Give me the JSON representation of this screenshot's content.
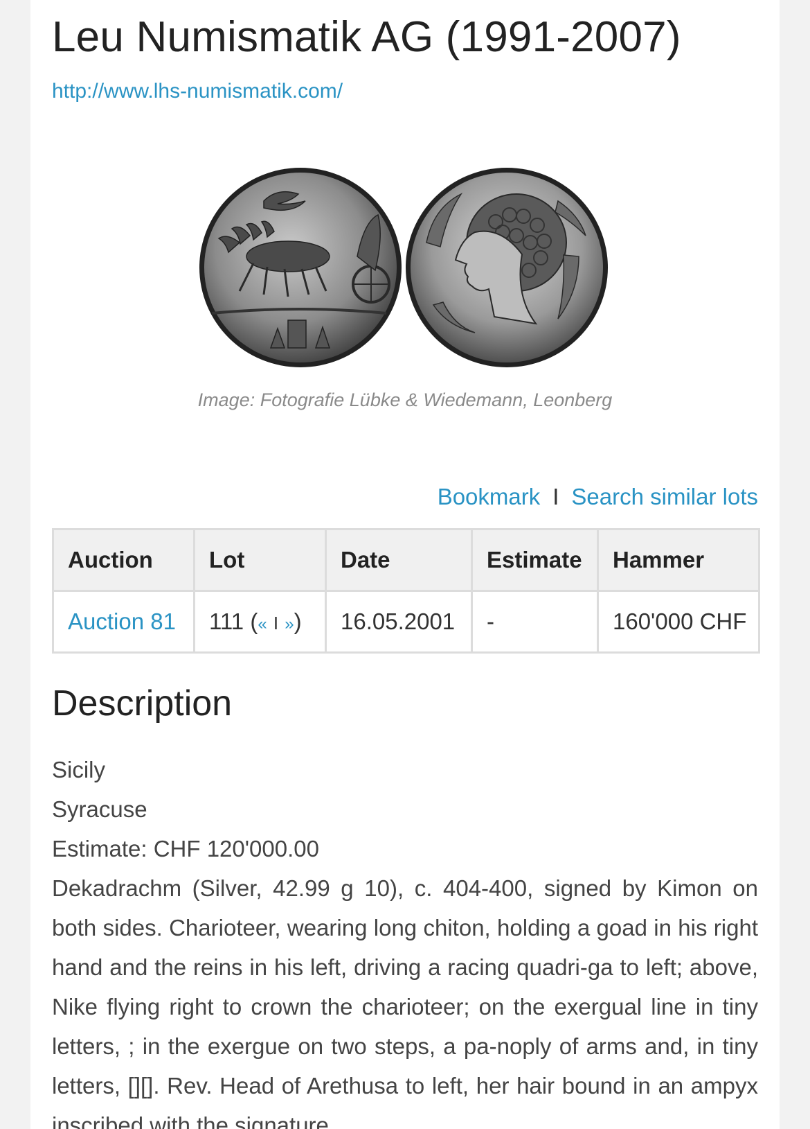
{
  "header": {
    "title": "Leu Numismatik AG (1991-2007)",
    "link": "http://www.lhs-numismatik.com/"
  },
  "image": {
    "caption": "Image: Fotografie Lübke & Wiedemann, Leonberg"
  },
  "actions": {
    "bookmark": "Bookmark",
    "separator": "I",
    "search_similar": "Search similar lots"
  },
  "table": {
    "headers": [
      "Auction",
      "Lot",
      "Date",
      "Estimate",
      "Hammer"
    ],
    "row": {
      "auction": "Auction 81",
      "lot_number": "111",
      "lot_prev": "«",
      "lot_sep": "I",
      "lot_next": "»",
      "date": "16.05.2001",
      "estimate": "-",
      "hammer": "160'000 CHF"
    }
  },
  "description": {
    "heading": "Description",
    "region": "Sicily",
    "city": "Syracuse",
    "estimate": "Estimate: CHF 120'000.00",
    "text": "Dekadrachm (Silver, 42.99 g 10), c. 404-400, signed by Kimon on both sides. Charioteer, wearing long chiton, holding a goad in his right hand and the reins in his left, driving a racing quadri-ga to left; above, Nike flying right to crown the charioteer; on the exergual line in tiny letters, ; in the exergue on two steps, a pa-noply of arms and, in tiny letters, [][]. Rev. Head of Arethusa to left, her hair bound in an ampyx inscribed with the signature"
  },
  "colors": {
    "link": "#2a93c4",
    "page_bg": "#ffffff",
    "outer_bg": "#f2f2f2",
    "header_cell_bg": "#f0f0f0"
  }
}
